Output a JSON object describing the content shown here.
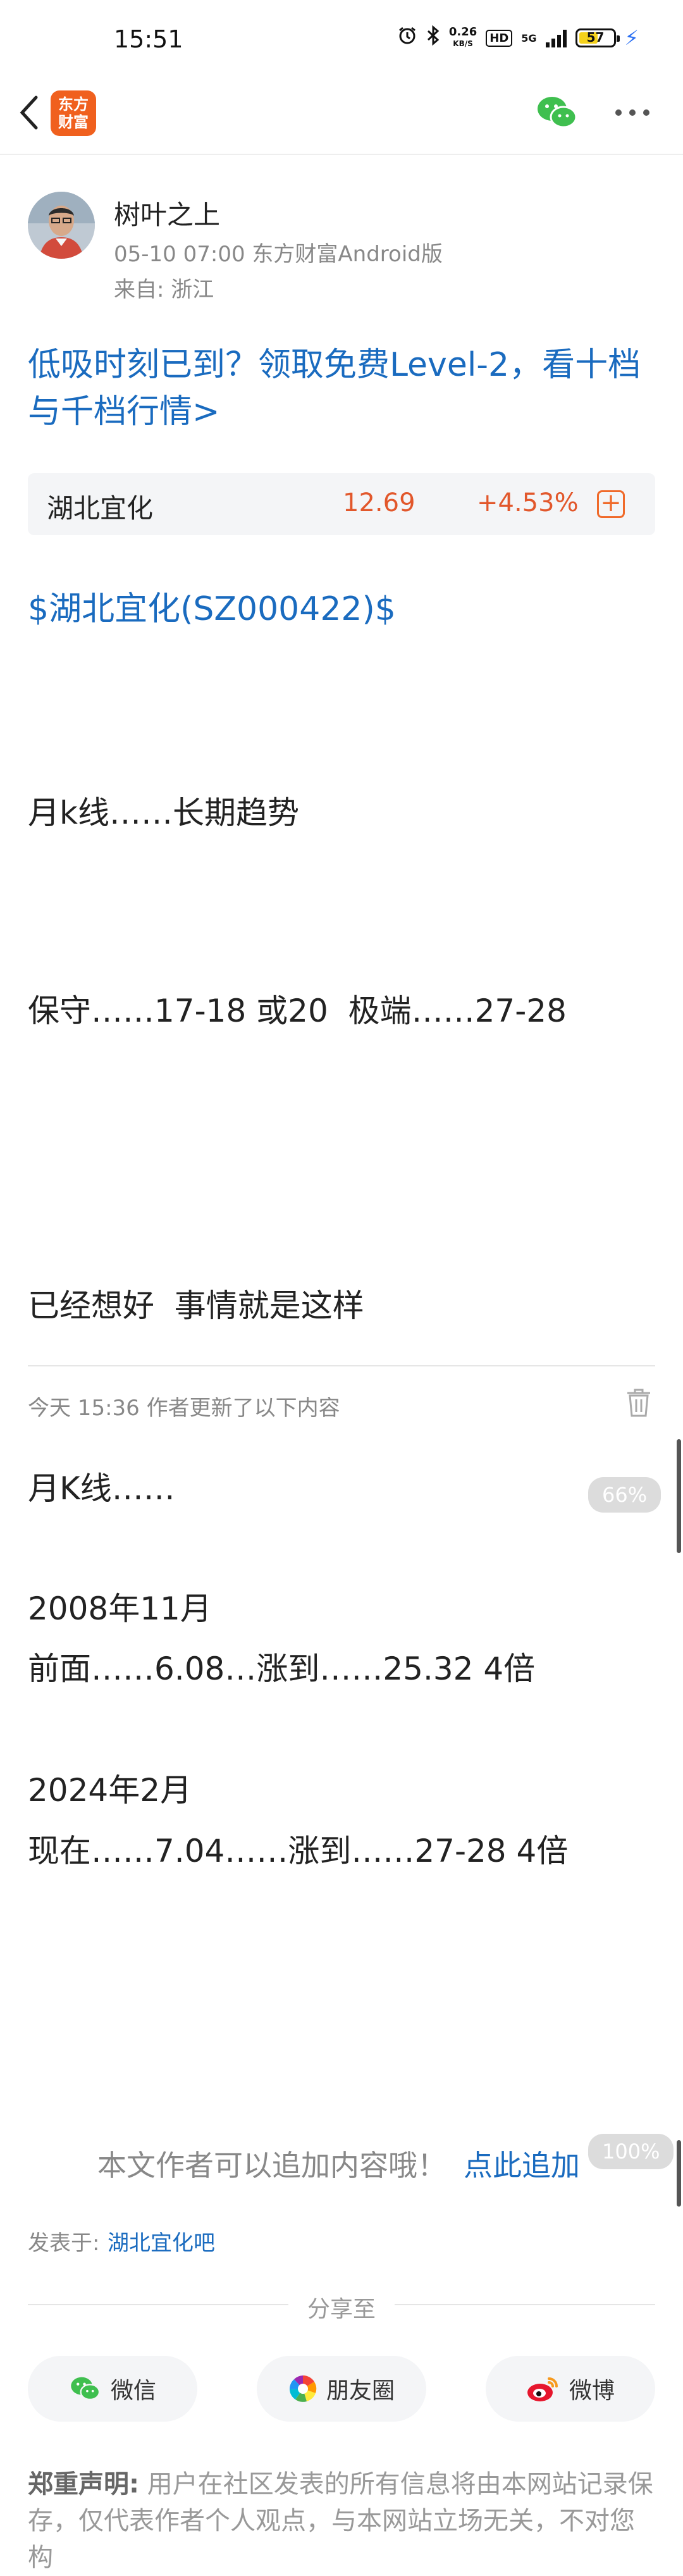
{
  "status_bar": {
    "time": "15:51",
    "net_speed_value": "0.26",
    "net_speed_unit": "KB/S",
    "hd": "HD",
    "network": "5G",
    "battery": "57",
    "battery_level": 0.57
  },
  "nav": {
    "logo_line1": "东方",
    "logo_line2": "财富"
  },
  "author": {
    "name": "树叶之上",
    "meta": "05-10 07:00 东方财富Android版",
    "location": "来自: 浙江"
  },
  "promo": "低吸时刻已到？领取免费Level-2，看十档与千档行情>",
  "stock": {
    "name": "湖北宜化",
    "price": "12.69",
    "change": "+4.53%",
    "add": "+"
  },
  "post": {
    "tag": "$湖北宜化(SZ000422)$",
    "line1": "月k线……长期趋势",
    "line2": "保守……17-18 或20  极端……27-28",
    "line3": "已经想好  事情就是这样"
  },
  "update": {
    "note": "今天 15:36  作者更新了以下内容",
    "line1": "月K线……",
    "line2": "2008年11月",
    "line3": "前面……6.08…涨到……25.32 4倍",
    "line4": "2024年2月",
    "line5": "现在……7.04……涨到……27-28 4倍"
  },
  "scroll_pct": {
    "first": "66%",
    "second": "100%"
  },
  "append": {
    "text": "本文作者可以追加内容哦！",
    "link": "点此追加"
  },
  "posted": {
    "label": "发表于:",
    "bar": "湖北宜化吧"
  },
  "share": {
    "title": "分享至",
    "wechat": "微信",
    "moments": "朋友圈",
    "weibo": "微博"
  },
  "disclaimer": {
    "title": "郑重声明:",
    "text": " 用户在社区发表的所有信息将由本网站记录保存，仅代表作者个人观点，与本网站立场无关，不对您构"
  },
  "colors": {
    "link": "#1a6bbf",
    "stock_up": "#e2572b",
    "brand": "#f0601e"
  }
}
